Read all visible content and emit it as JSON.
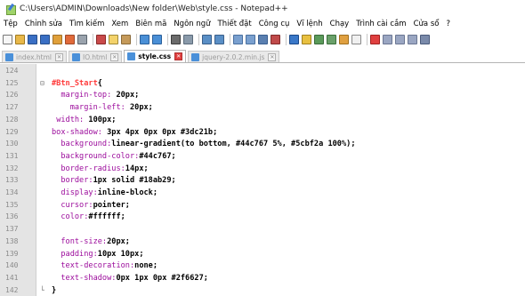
{
  "window": {
    "title": "C:\\Users\\ADMIN\\Downloads\\New folder\\Web\\style.css - Notepad++"
  },
  "menu": [
    "Tệp",
    "Chỉnh sửa",
    "Tìm kiếm",
    "Xem",
    "Biên mã",
    "Ngôn ngữ",
    "Thiết đặt",
    "Công cụ",
    "Vĩ lệnh",
    "Chạy",
    "Trình cài cắm",
    "Cửa sổ",
    "?"
  ],
  "toolbar_icons": [
    {
      "name": "new-file-icon",
      "color": "#f6f6f6",
      "border": "#777"
    },
    {
      "name": "open-file-icon",
      "color": "#e8b84a",
      "border": "#a07a20"
    },
    {
      "name": "save-icon",
      "color": "#3a6fc4",
      "border": "#274e8a"
    },
    {
      "name": "save-all-icon",
      "color": "#3a6fc4",
      "border": "#274e8a"
    },
    {
      "name": "close-icon",
      "color": "#e0a03a",
      "border": "#a0702a"
    },
    {
      "name": "close-all-icon",
      "color": "#e06a3a",
      "border": "#a04a2a"
    },
    {
      "name": "print-icon",
      "color": "#9aa3ad",
      "border": "#5a636d"
    },
    {
      "sep": true
    },
    {
      "name": "cut-icon",
      "color": "#c94a4a",
      "border": "#8a2a2a"
    },
    {
      "name": "copy-icon",
      "color": "#f3d26a",
      "border": "#a08a3a"
    },
    {
      "name": "paste-icon",
      "color": "#c59a5a",
      "border": "#8a6a3a"
    },
    {
      "sep": true
    },
    {
      "name": "undo-icon",
      "color": "#4a8fd6",
      "border": "#2a5f9a"
    },
    {
      "name": "redo-icon",
      "color": "#4a8fd6",
      "border": "#2a5f9a"
    },
    {
      "sep": true
    },
    {
      "name": "find-icon",
      "color": "#6b6b6b",
      "border": "#3b3b3b"
    },
    {
      "name": "replace-icon",
      "color": "#8a9aaa",
      "border": "#5a6a7a"
    },
    {
      "sep": true
    },
    {
      "name": "zoom-in-icon",
      "color": "#5a8fc6",
      "border": "#3a5f8a"
    },
    {
      "name": "zoom-out-icon",
      "color": "#5a8fc6",
      "border": "#3a5f8a"
    },
    {
      "sep": true
    },
    {
      "name": "sync-vertical-icon",
      "color": "#7aa0cf",
      "border": "#4a709f"
    },
    {
      "name": "sync-horizontal-icon",
      "color": "#7aa0cf",
      "border": "#4a709f"
    },
    {
      "name": "word-wrap-icon",
      "color": "#5a7fb0",
      "border": "#3a5f90"
    },
    {
      "name": "show-all-chars-icon",
      "color": "#c04a4a",
      "border": "#802a2a"
    },
    {
      "sep": true
    },
    {
      "name": "indent-guide-icon",
      "color": "#3a78c8",
      "border": "#1a4888"
    },
    {
      "name": "lang-define-icon",
      "color": "#e8c040",
      "border": "#a08020"
    },
    {
      "name": "doc-map-icon",
      "color": "#5a9a5a",
      "border": "#3a6a3a"
    },
    {
      "name": "function-list-icon",
      "color": "#6aa06a",
      "border": "#3a703a"
    },
    {
      "name": "folder-workspace-icon",
      "color": "#e0a040",
      "border": "#a07020"
    },
    {
      "name": "monitor-icon",
      "color": "#f0f0f0",
      "border": "#888"
    },
    {
      "sep": true
    },
    {
      "name": "record-macro-icon",
      "color": "#e04040",
      "border": "#a02020"
    },
    {
      "name": "stop-record-icon",
      "color": "#9aa6c2",
      "border": "#6a7692"
    },
    {
      "name": "playback-icon",
      "color": "#9aa6c2",
      "border": "#6a7692"
    },
    {
      "name": "run-macro-multiple-icon",
      "color": "#9aa6c2",
      "border": "#6a7692"
    },
    {
      "name": "save-macro-icon",
      "color": "#7a8aaa",
      "border": "#4a5a7a"
    }
  ],
  "tabs": [
    {
      "label": "index.html",
      "active": false
    },
    {
      "label": "IO.html",
      "active": false
    },
    {
      "label": "style.css",
      "active": true
    },
    {
      "label": "jquery-2.0.2.min.js",
      "active": false
    }
  ],
  "code_lines": [
    {
      "n": "124",
      "fold": "",
      "indent": "",
      "sel": "",
      "prop": "",
      "val": ""
    },
    {
      "n": "125",
      "fold": "⊟",
      "indent": "",
      "sel": "#Btn_Start",
      "prop": "",
      "val": "{"
    },
    {
      "n": "126",
      "fold": "",
      "indent": "  ",
      "sel": "",
      "prop": "margin-top: ",
      "val": "20px;"
    },
    {
      "n": "127",
      "fold": "",
      "indent": "    ",
      "sel": "",
      "prop": "margin-left: ",
      "val": "20px;"
    },
    {
      "n": "128",
      "fold": "",
      "indent": " ",
      "sel": "",
      "prop": "width: ",
      "val": "100px;"
    },
    {
      "n": "129",
      "fold": "",
      "indent": "",
      "sel": "",
      "prop": "box-shadow: ",
      "val": "3px 4px 0px 0px #3dc21b;"
    },
    {
      "n": "130",
      "fold": "",
      "indent": "  ",
      "sel": "",
      "prop": "background:",
      "val": "linear-gradient(to bottom, #44c767 5%, #5cbf2a 100%);"
    },
    {
      "n": "131",
      "fold": "",
      "indent": "  ",
      "sel": "",
      "prop": "background-color:",
      "val": "#44c767;"
    },
    {
      "n": "132",
      "fold": "",
      "indent": "  ",
      "sel": "",
      "prop": "border-radius:",
      "val": "14px;"
    },
    {
      "n": "133",
      "fold": "",
      "indent": "  ",
      "sel": "",
      "prop": "border:",
      "val": "1px solid #18ab29;"
    },
    {
      "n": "134",
      "fold": "",
      "indent": "  ",
      "sel": "",
      "prop": "display:",
      "val": "inline-block;"
    },
    {
      "n": "135",
      "fold": "",
      "indent": "  ",
      "sel": "",
      "prop": "cursor:",
      "val": "pointer;"
    },
    {
      "n": "136",
      "fold": "",
      "indent": "  ",
      "sel": "",
      "prop": "color:",
      "val": "#ffffff;"
    },
    {
      "n": "137",
      "fold": "",
      "indent": "",
      "sel": "",
      "prop": "",
      "val": ""
    },
    {
      "n": "138",
      "fold": "",
      "indent": "  ",
      "sel": "",
      "prop": "font-size:",
      "val": "20px;"
    },
    {
      "n": "139",
      "fold": "",
      "indent": "  ",
      "sel": "",
      "prop": "padding:",
      "val": "10px 10px;"
    },
    {
      "n": "140",
      "fold": "",
      "indent": "  ",
      "sel": "",
      "prop": "text-decoration:",
      "val": "none;"
    },
    {
      "n": "141",
      "fold": "",
      "indent": "  ",
      "sel": "",
      "prop": "text-shadow:",
      "val": "0px 1px 0px #2f6627;"
    },
    {
      "n": "142",
      "fold": "└",
      "indent": "",
      "sel": "",
      "prop": "",
      "val": "}"
    }
  ]
}
